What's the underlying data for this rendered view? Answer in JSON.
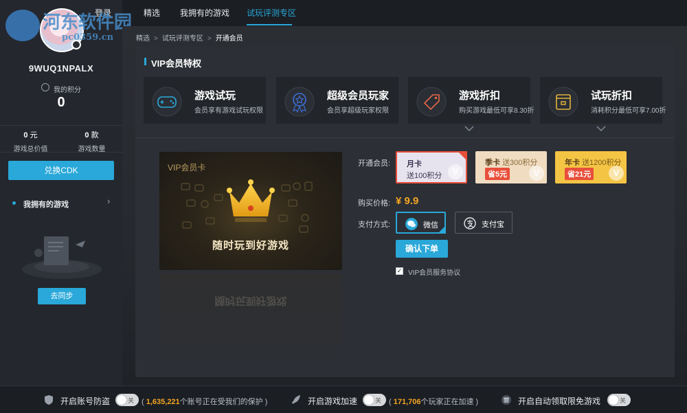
{
  "watermark": {
    "text": "河东软件园",
    "url": "pc0359.cn"
  },
  "user": {
    "username": "9WUQ1NPALX",
    "points_label": "我的积分",
    "points_value": "0"
  },
  "stats": [
    {
      "value": "0",
      "unit": "元",
      "label": "游戏总价值"
    },
    {
      "value": "0",
      "unit": "款",
      "label": "游戏数量"
    }
  ],
  "sidebar": {
    "cdk_label": "兑换CDK",
    "owned_label": "我拥有的游戏",
    "sync_label": "去同步"
  },
  "nav": {
    "items": [
      "登录",
      "精选",
      "我拥有的游戏",
      "试玩评测专区"
    ],
    "active": "试玩评测专区"
  },
  "breadcrumb": [
    "精选",
    "试玩评测专区",
    "开通会员"
  ],
  "panel": {
    "title": "VIP会员特权"
  },
  "perks": [
    {
      "icon": "gamepad-icon",
      "title": "游戏试玩",
      "desc": "会员享有游戏试玩权限"
    },
    {
      "icon": "medal-icon",
      "title": "超级会员玩家",
      "desc": "会员享超级玩家权限"
    },
    {
      "icon": "tag-icon",
      "title": "游戏折扣",
      "desc": "购买游戏最低可享8.30折"
    },
    {
      "icon": "wallet-icon",
      "title": "试玩折扣",
      "desc": "消耗积分最低可享7.00折"
    }
  ],
  "vipcard": {
    "label": "VIP会员卡",
    "slogan": "随时玩到好游戏"
  },
  "purchase": {
    "plan_label": "开通会员:",
    "plans": [
      {
        "name": "月卡",
        "desc": "送100积分",
        "save": "",
        "selected": true
      },
      {
        "name": "季卡",
        "desc": "送300积分",
        "save": "省5元",
        "selected": false
      },
      {
        "name": "年卡",
        "desc": "送1200积分",
        "save": "省21元",
        "selected": false
      }
    ],
    "price_label": "购买价格:",
    "price": "¥ 9.9",
    "pay_label": "支付方式:",
    "pay_methods": [
      {
        "name": "微信",
        "selected": true
      },
      {
        "name": "支付宝",
        "selected": false
      }
    ],
    "confirm_label": "确认下单",
    "agreement_label": "VIP会员服务协议",
    "agreement_checked": true
  },
  "footer": [
    {
      "icon": "shield-icon",
      "label": "开启账号防盗",
      "toggle": "关",
      "count": "1,635,221",
      "note_suffix": "个账号正在受我们的保护"
    },
    {
      "icon": "rocket-icon",
      "label": "开启游戏加速",
      "toggle": "关",
      "count": "171,706",
      "note_suffix": "个玩家正在加速"
    },
    {
      "icon": "gift-icon",
      "label": "开启自动领取限免游戏",
      "toggle": "关",
      "count": "",
      "note_suffix": ""
    }
  ],
  "colors": {
    "accent": "#29a8d9",
    "price": "#f5a623",
    "selected_plan_border": "#e84f3a",
    "background": "#1e2127"
  }
}
